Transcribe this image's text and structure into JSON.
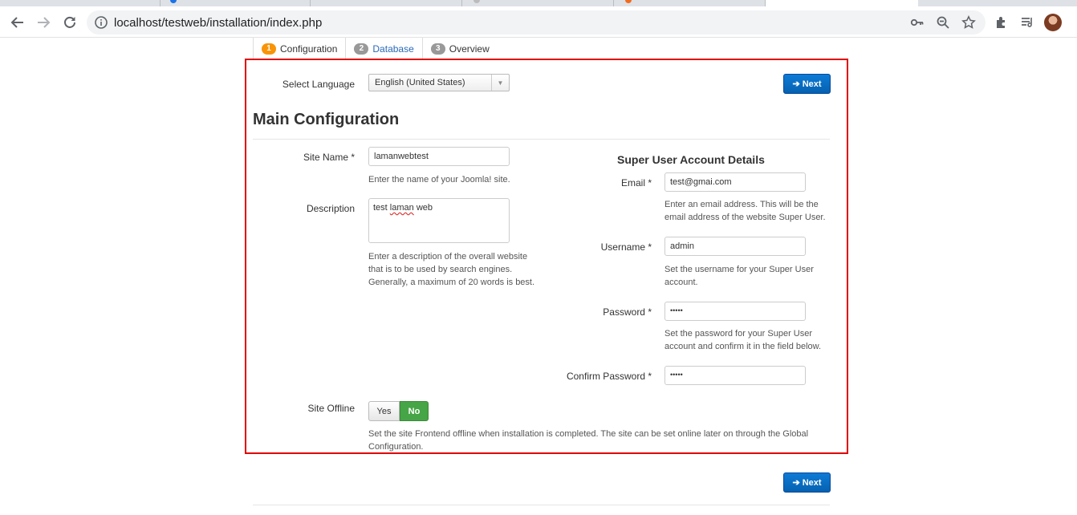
{
  "browser": {
    "url": "localhost/testweb/installation/index.php"
  },
  "steps": [
    {
      "num": "1",
      "label": "Configuration"
    },
    {
      "num": "2",
      "label": "Database"
    },
    {
      "num": "3",
      "label": "Overview"
    }
  ],
  "language": {
    "label": "Select Language",
    "value": "English (United States)"
  },
  "next_label": "➔ Next",
  "main": {
    "title": "Main Configuration",
    "site_name": {
      "label": "Site Name *",
      "value": "lamanwebtest",
      "help": "Enter the name of your Joomla! site."
    },
    "description": {
      "label": "Description",
      "value_pre": "test ",
      "value_mark": "laman",
      "value_post": " web",
      "help": "Enter a description of the overall website that is to be used by search engines. Generally, a maximum of 20 words is best."
    },
    "site_offline": {
      "label": "Site Offline",
      "yes": "Yes",
      "no": "No",
      "help": "Set the site Frontend offline when installation is completed. The site can be set online later on through the Global Configuration."
    }
  },
  "super_user": {
    "title": "Super User Account Details",
    "email": {
      "label": "Email *",
      "value": "test@gmai.com",
      "help": "Enter an email address. This will be the email address of the website Super User."
    },
    "username": {
      "label": "Username *",
      "value": "admin",
      "help": "Set the username for your Super User account."
    },
    "password": {
      "label": "Password *",
      "value": "•••••",
      "help": "Set the password for your Super User account and confirm it in the field below."
    },
    "confirm_password": {
      "label": "Confirm Password *",
      "value": "•••••"
    }
  },
  "colors": {
    "frame": "#e00000",
    "primary_button": "#0561b0",
    "toggle_on": "#46a546",
    "step_active": "#f89406"
  }
}
